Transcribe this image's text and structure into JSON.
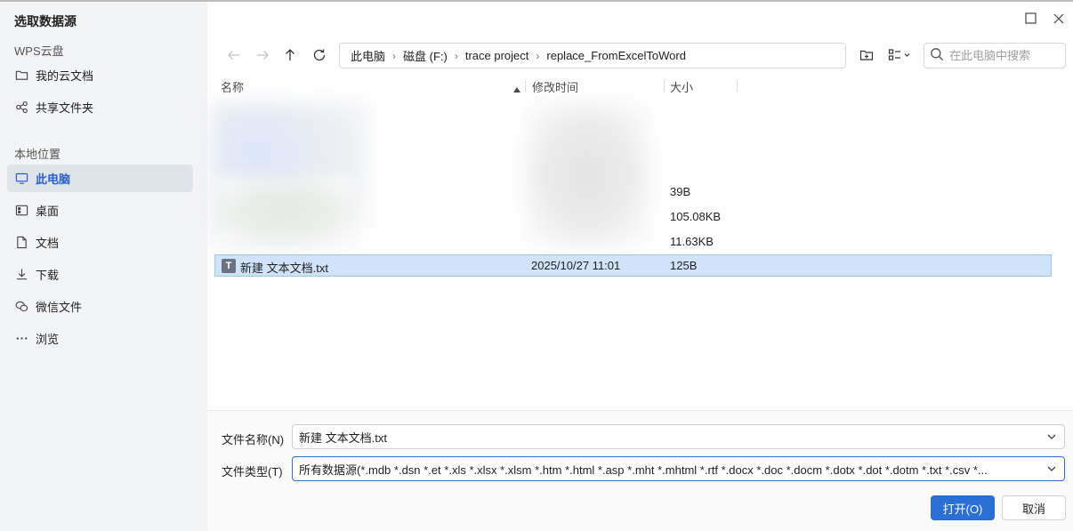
{
  "dialog": {
    "title": "选取数据源"
  },
  "sidebar": {
    "cloud_section": "WPS云盘",
    "cloud_items": [
      {
        "label": "我的云文档",
        "icon": "folder-icon"
      },
      {
        "label": "共享文件夹",
        "icon": "share-icon"
      }
    ],
    "local_section": "本地位置",
    "local_items": [
      {
        "label": "此电脑",
        "icon": "computer-icon",
        "active": true
      },
      {
        "label": "桌面",
        "icon": "desktop-icon"
      },
      {
        "label": "文档",
        "icon": "document-icon"
      },
      {
        "label": "下载",
        "icon": "download-icon"
      },
      {
        "label": "微信文件",
        "icon": "wechat-icon"
      },
      {
        "label": "浏览",
        "icon": "more-icon"
      }
    ]
  },
  "breadcrumb": [
    "此电脑",
    "磁盘 (F:)",
    "trace project",
    "replace_FromExcelToWord"
  ],
  "search": {
    "placeholder": "在此电脑中搜索"
  },
  "columns": {
    "name": "名称",
    "modified": "修改时间",
    "size": "大小"
  },
  "blurred_sizes": [
    "39B",
    "105.08KB",
    "11.63KB"
  ],
  "selected_file": {
    "icon_letter": "T",
    "name": "新建 文本文档.txt",
    "modified": "2025/10/27 11:01",
    "size": "125B"
  },
  "form": {
    "filename_label": "文件名称(N)",
    "filename_value": "新建 文本文档.txt",
    "filetype_label": "文件类型(T)",
    "filetype_value": "所有数据源(*.mdb *.dsn *.et *.xls *.xlsx *.xlsm *.htm *.html *.asp *.mht *.mhtml *.rtf *.docx *.doc *.docm *.dotx *.dot *.dotm *.txt *.csv *..."
  },
  "buttons": {
    "open": "打开(O)",
    "cancel": "取消"
  },
  "colors": {
    "accent": "#2b6fd6",
    "selection": "#cfe4f9",
    "sidebar_bg": "#f3f4f6"
  }
}
